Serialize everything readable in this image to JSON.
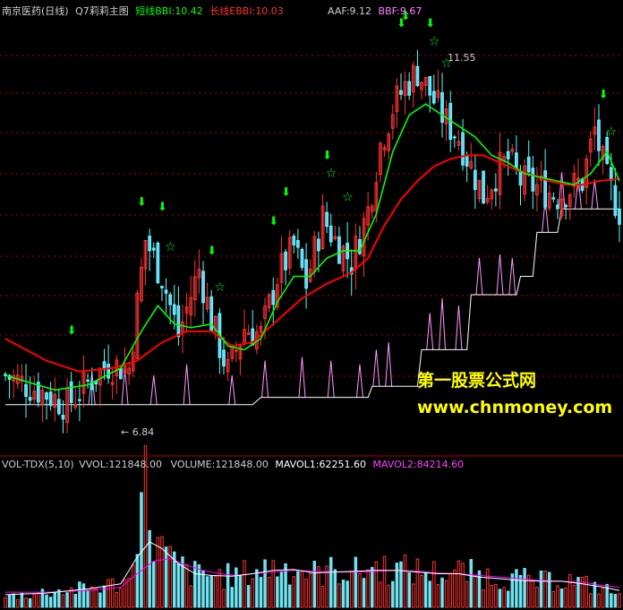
{
  "header": {
    "stock_name": "南京医药(日线)",
    "indicator_name": "Q7莉莉主图",
    "short_bbi_label": "短线BBI:",
    "short_bbi_value": "10.42",
    "long_bbi_label": "长线EBBI:",
    "long_bbi_value": "10.03",
    "aaf_label": "AAF:",
    "aaf_value": "9.12",
    "bbf_label": "BBF:",
    "bbf_value": "9.67"
  },
  "volume_header": {
    "name": "VOL-TDX(5,10)",
    "vvol_label": "VVOL:",
    "vvol_value": "121848.00",
    "volume_label": "VOLUME:",
    "volume_value": "121848.00",
    "mavol1_label": "MAVOL1:",
    "mavol1_value": "62251.60",
    "mavol2_label": "MAVOL2:",
    "mavol2_value": "84214.60"
  },
  "annotations": {
    "high_label": "11.55",
    "low_label": "← 6.84",
    "star_glyph": "☆",
    "arrow_glyph": "⬇"
  },
  "watermark": {
    "line1": "第一股票公式网",
    "line2": "www.chnmoney.com"
  },
  "colors": {
    "background": "#000000",
    "up_candle": "#ff3232",
    "down_candle": "#54ffff",
    "down_candle_fill": "#7fc8ff",
    "short_bbi": "#00ff00",
    "long_bbi": "#ff0000",
    "step_line": "#ffffff",
    "spike_line": "#ff99ff",
    "vol_up": "#ff3232",
    "vol_down": "#6fe3f0",
    "mavol1": "#ffffff",
    "mavol2": "#ff00ff",
    "grid": "#b00000",
    "watermark1": "#ffff00",
    "watermark2": "#ffff00",
    "arrow": "#00ff00",
    "star": "#00ff00"
  },
  "chart_data": {
    "type": "candlestick",
    "price_ylim": [
      6.3,
      12.2
    ],
    "x_count": 150,
    "close_path": [
      [
        0,
        7.35
      ],
      [
        10,
        7.1
      ],
      [
        15,
        6.95
      ],
      [
        20,
        7.25
      ],
      [
        25,
        7.5
      ],
      [
        30,
        7.45
      ],
      [
        34,
        9.2
      ],
      [
        38,
        8.7
      ],
      [
        42,
        7.9
      ],
      [
        47,
        8.8
      ],
      [
        50,
        8.1
      ],
      [
        54,
        7.4
      ],
      [
        58,
        8.0
      ],
      [
        62,
        7.9
      ],
      [
        66,
        8.7
      ],
      [
        70,
        9.1
      ],
      [
        73,
        8.6
      ],
      [
        77,
        9.5
      ],
      [
        80,
        9.2
      ],
      [
        84,
        8.9
      ],
      [
        88,
        9.6
      ],
      [
        91,
        10.5
      ],
      [
        94,
        11.0
      ],
      [
        97,
        11.3
      ],
      [
        100,
        11.5
      ],
      [
        103,
        11.2
      ],
      [
        107,
        10.8
      ],
      [
        110,
        10.6
      ],
      [
        113,
        10.2
      ],
      [
        116,
        9.8
      ],
      [
        119,
        10.1
      ],
      [
        122,
        10.3
      ],
      [
        125,
        10.0
      ],
      [
        130,
        9.9
      ],
      [
        134,
        9.8
      ],
      [
        137,
        9.9
      ],
      [
        140,
        10.0
      ],
      [
        143,
        10.7
      ],
      [
        146,
        10.0
      ],
      [
        149,
        9.6
      ]
    ],
    "short_bbi": [
      [
        0,
        7.35
      ],
      [
        12,
        7.15
      ],
      [
        20,
        7.22
      ],
      [
        28,
        7.45
      ],
      [
        33,
        7.95
      ],
      [
        37,
        8.3
      ],
      [
        41,
        8.05
      ],
      [
        45,
        8.0
      ],
      [
        50,
        8.05
      ],
      [
        54,
        7.75
      ],
      [
        58,
        7.7
      ],
      [
        62,
        7.85
      ],
      [
        66,
        8.35
      ],
      [
        70,
        8.7
      ],
      [
        74,
        8.7
      ],
      [
        78,
        8.95
      ],
      [
        82,
        9.05
      ],
      [
        86,
        9.05
      ],
      [
        90,
        9.55
      ],
      [
        94,
        10.4
      ],
      [
        98,
        10.9
      ],
      [
        102,
        11.05
      ],
      [
        106,
        10.9
      ],
      [
        110,
        10.75
      ],
      [
        114,
        10.6
      ],
      [
        118,
        10.35
      ],
      [
        122,
        10.25
      ],
      [
        126,
        10.1
      ],
      [
        130,
        10.05
      ],
      [
        134,
        10.0
      ],
      [
        138,
        9.95
      ],
      [
        142,
        10.1
      ],
      [
        146,
        10.4
      ],
      [
        149,
        10.0
      ]
    ],
    "long_bbi": [
      [
        0,
        7.85
      ],
      [
        10,
        7.55
      ],
      [
        18,
        7.4
      ],
      [
        26,
        7.45
      ],
      [
        32,
        7.55
      ],
      [
        38,
        7.8
      ],
      [
        44,
        7.95
      ],
      [
        50,
        7.95
      ],
      [
        55,
        7.75
      ],
      [
        60,
        7.8
      ],
      [
        66,
        8.1
      ],
      [
        72,
        8.4
      ],
      [
        78,
        8.6
      ],
      [
        84,
        8.75
      ],
      [
        88,
        8.95
      ],
      [
        92,
        9.4
      ],
      [
        96,
        9.75
      ],
      [
        100,
        10.0
      ],
      [
        104,
        10.2
      ],
      [
        108,
        10.3
      ],
      [
        112,
        10.35
      ],
      [
        116,
        10.35
      ],
      [
        120,
        10.25
      ],
      [
        124,
        10.15
      ],
      [
        128,
        10.08
      ],
      [
        132,
        10.0
      ],
      [
        136,
        9.95
      ],
      [
        140,
        9.95
      ],
      [
        144,
        10.0
      ],
      [
        149,
        10.03
      ]
    ],
    "step_line": [
      [
        0,
        6.95
      ],
      [
        28,
        6.95
      ],
      [
        28,
        6.95
      ],
      [
        60,
        6.95
      ],
      [
        62,
        7.05
      ],
      [
        88,
        7.05
      ],
      [
        89,
        7.2
      ],
      [
        100,
        7.2
      ],
      [
        101,
        7.7
      ],
      [
        112,
        7.7
      ],
      [
        113,
        8.45
      ],
      [
        124,
        8.45
      ],
      [
        125,
        8.7
      ],
      [
        128,
        8.7
      ],
      [
        129,
        9.3
      ],
      [
        134,
        9.3
      ],
      [
        135,
        9.62
      ],
      [
        149,
        9.62
      ]
    ],
    "spike_x": [
      21,
      29,
      36,
      44,
      55,
      63,
      72,
      79,
      86,
      90,
      93,
      103,
      106,
      110,
      115,
      120,
      123,
      131,
      135,
      139,
      143
    ],
    "spike_height": [
      0.45,
      0.5,
      0.4,
      0.55,
      0.4,
      0.5,
      0.55,
      0.5,
      0.45,
      0.5,
      0.6,
      0.5,
      0.7,
      0.6,
      0.5,
      0.55,
      0.5,
      0.45,
      0.5,
      0.45,
      0.4
    ],
    "volume_ylim": [
      0,
      160000
    ],
    "volume": [
      [
        0,
        12000
      ],
      [
        10,
        18000
      ],
      [
        20,
        22000
      ],
      [
        30,
        30000
      ],
      [
        32,
        110000
      ],
      [
        34,
        145000
      ],
      [
        36,
        80000
      ],
      [
        40,
        55000
      ],
      [
        45,
        40000
      ],
      [
        50,
        38000
      ],
      [
        55,
        36000
      ],
      [
        60,
        42000
      ],
      [
        65,
        48000
      ],
      [
        70,
        46000
      ],
      [
        75,
        40000
      ],
      [
        80,
        44000
      ],
      [
        85,
        42000
      ],
      [
        90,
        48000
      ],
      [
        95,
        45000
      ],
      [
        100,
        43000
      ],
      [
        105,
        40000
      ],
      [
        110,
        42000
      ],
      [
        115,
        38000
      ],
      [
        120,
        35000
      ],
      [
        125,
        33000
      ],
      [
        130,
        30000
      ],
      [
        135,
        34000
      ],
      [
        140,
        28000
      ],
      [
        145,
        22000
      ],
      [
        149,
        15000
      ]
    ],
    "mavol1": [
      [
        0,
        15000
      ],
      [
        10,
        17000
      ],
      [
        20,
        22000
      ],
      [
        28,
        28000
      ],
      [
        32,
        60000
      ],
      [
        35,
        78000
      ],
      [
        38,
        70000
      ],
      [
        42,
        52000
      ],
      [
        46,
        40000
      ],
      [
        50,
        38000
      ],
      [
        55,
        37000
      ],
      [
        60,
        40000
      ],
      [
        65,
        44000
      ],
      [
        70,
        45000
      ],
      [
        75,
        41000
      ],
      [
        80,
        42000
      ],
      [
        85,
        43000
      ],
      [
        90,
        44000
      ],
      [
        95,
        44000
      ],
      [
        100,
        42000
      ],
      [
        105,
        40000
      ],
      [
        110,
        40000
      ],
      [
        115,
        36000
      ],
      [
        120,
        34000
      ],
      [
        125,
        32000
      ],
      [
        130,
        31000
      ],
      [
        135,
        31000
      ],
      [
        140,
        28000
      ],
      [
        145,
        24000
      ],
      [
        149,
        20000
      ]
    ],
    "mavol2": [
      [
        0,
        18000
      ],
      [
        10,
        18000
      ],
      [
        20,
        20000
      ],
      [
        28,
        24000
      ],
      [
        32,
        40000
      ],
      [
        36,
        55000
      ],
      [
        40,
        58000
      ],
      [
        44,
        50000
      ],
      [
        48,
        44000
      ],
      [
        52,
        40000
      ],
      [
        56,
        38000
      ],
      [
        60,
        40000
      ],
      [
        65,
        42000
      ],
      [
        70,
        44000
      ],
      [
        75,
        43000
      ],
      [
        80,
        42000
      ],
      [
        85,
        42000
      ],
      [
        90,
        43000
      ],
      [
        95,
        44000
      ],
      [
        100,
        43000
      ],
      [
        105,
        41000
      ],
      [
        110,
        40000
      ],
      [
        115,
        38000
      ],
      [
        120,
        36000
      ],
      [
        125,
        34000
      ],
      [
        130,
        32000
      ],
      [
        135,
        31000
      ],
      [
        140,
        30000
      ],
      [
        145,
        26000
      ],
      [
        149,
        24000
      ]
    ],
    "arrows_x": [
      16,
      33,
      38,
      50,
      65,
      68,
      78,
      96,
      97,
      103,
      145
    ],
    "stars_x": [
      40,
      52,
      79,
      83,
      104,
      107,
      147
    ]
  }
}
